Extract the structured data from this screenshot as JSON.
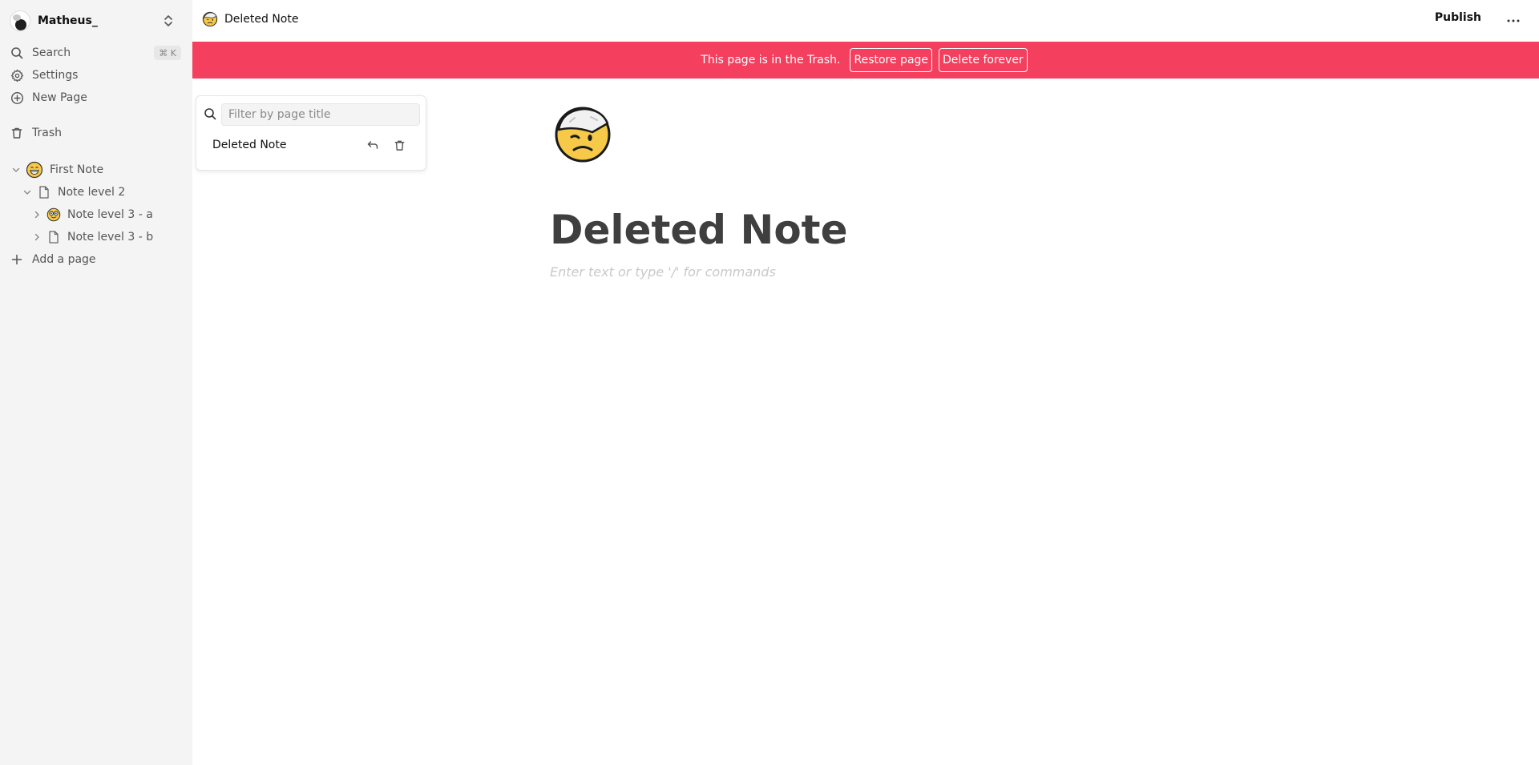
{
  "workspace": {
    "name": "Matheus_"
  },
  "sidebar": {
    "search_label": "Search",
    "search_shortcut": "⌘ K",
    "settings_label": "Settings",
    "new_page_label": "New Page",
    "trash_label": "Trash",
    "pages": [
      {
        "label": "First Note",
        "icon": "grinning-face-emoji"
      },
      {
        "label": "Note level 2",
        "icon": "page-icon"
      },
      {
        "label": "Note level 3 - a",
        "icon": "nerd-face-emoji"
      },
      {
        "label": "Note level 3 - b",
        "icon": "page-icon"
      }
    ],
    "add_page_label": "Add a page"
  },
  "header": {
    "title": "Deleted Note",
    "publish_label": "Publish",
    "icon": "face-with-head-bandage-emoji"
  },
  "banner": {
    "message": "This page is in the Trash.",
    "restore_label": "Restore page",
    "delete_label": "Delete forever",
    "color": "#f43f5e"
  },
  "trash_popover": {
    "filter_placeholder": "Filter by page title",
    "items": [
      {
        "label": "Deleted Note"
      }
    ]
  },
  "editor": {
    "title": "Deleted Note",
    "placeholder": "Enter text or type '/' for commands"
  }
}
